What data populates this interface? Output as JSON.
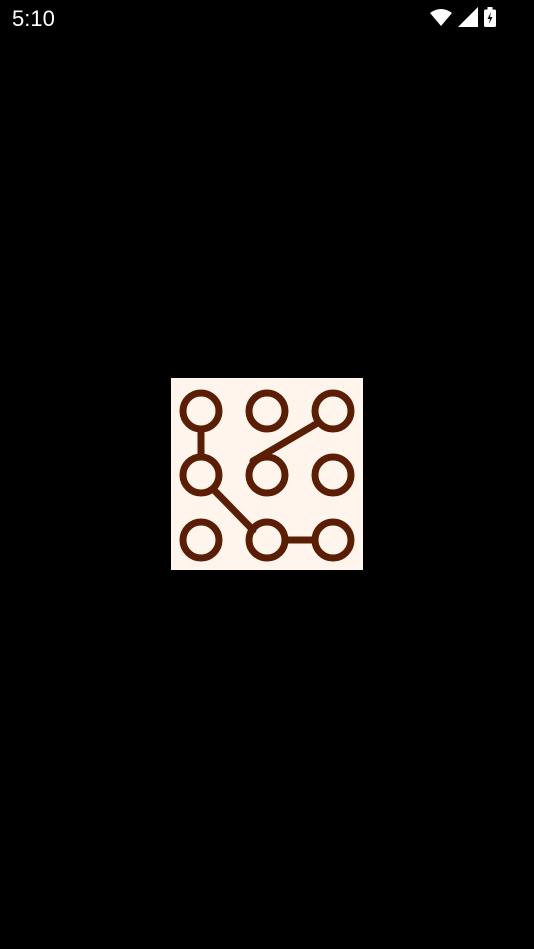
{
  "status_bar": {
    "time": "5:10",
    "icons": [
      "wifi-icon",
      "cellular-signal-icon",
      "battery-charging-icon"
    ]
  },
  "splash": {
    "logo_icon": "pattern-lock-icon",
    "logo_background_color": "#fff5ec",
    "logo_stroke_color": "#5a1e05"
  }
}
